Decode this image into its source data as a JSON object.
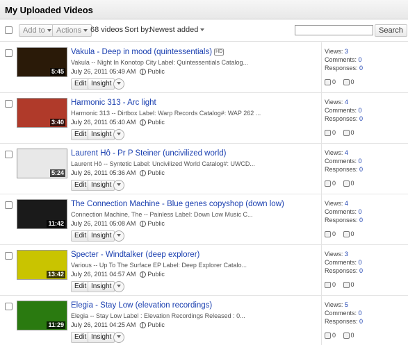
{
  "page_title": "My Uploaded Videos",
  "toolbar": {
    "add_to": "Add to",
    "actions": "Actions",
    "count": "68 videos",
    "sort_label": "Sort by:",
    "sort_value": "Newest added",
    "search_button": "Search",
    "search_value": ""
  },
  "row_labels": {
    "edit": "Edit",
    "insight": "Insight",
    "views": "Views:",
    "comments": "Comments:",
    "responses": "Responses:",
    "hd": "HD"
  },
  "videos": [
    {
      "title": "Vakula - Deep in mood (quintessentials)",
      "hd": true,
      "desc": "Vakula -- Night In Konotop City Label: Quintessentials Catalog...",
      "date": "July 26, 2011 05:49 AM",
      "privacy": "Public",
      "duration": "5:45",
      "views": "3",
      "comments": "0",
      "responses": "0",
      "likes": "0",
      "dislikes": "0",
      "thumb_color": "#2a1a08"
    },
    {
      "title": "Harmonic 313 - Arc light",
      "hd": false,
      "desc": "Harmonic 313 -- Dirtbox Label: Warp Records Catalog#: WAP 262 ...",
      "date": "July 26, 2011 05:40 AM",
      "privacy": "Public",
      "duration": "3:40",
      "views": "4",
      "comments": "0",
      "responses": "0",
      "likes": "0",
      "dislikes": "0",
      "thumb_color": "#b03a2a"
    },
    {
      "title": "Laurent Hô - Pr P Steiner (uncivilized world)",
      "hd": false,
      "desc": "Laurent Hô -- Syntetic Label: Uncivilized World Catalog#: UWCD...",
      "date": "July 26, 2011 05:36 AM",
      "privacy": "Public",
      "duration": "5:24",
      "views": "4",
      "comments": "0",
      "responses": "0",
      "likes": "0",
      "dislikes": "0",
      "thumb_color": "#e8e8e8"
    },
    {
      "title": "The Connection Machine - Blue genes copyshop (down low)",
      "hd": false,
      "desc": "Connection Machine, The -- Painless Label: Down Low Music C...",
      "date": "July 26, 2011 05:08 AM",
      "privacy": "Public",
      "duration": "11:42",
      "views": "4",
      "comments": "0",
      "responses": "0",
      "likes": "0",
      "dislikes": "0",
      "thumb_color": "#1a1a1a"
    },
    {
      "title": "Specter - Windtalker (deep explorer)",
      "hd": false,
      "desc": "Various -- Up To The Surface EP Label: Deep Explorer Catalo...",
      "date": "July 26, 2011 04:57 AM",
      "privacy": "Public",
      "duration": "13:42",
      "views": "3",
      "comments": "0",
      "responses": "0",
      "likes": "0",
      "dislikes": "0",
      "thumb_color": "#c9c400"
    },
    {
      "title": "Elegia - Stay Low (elevation recordings)",
      "hd": false,
      "desc": "Elegia -- Stay Low Label : Elevation Recordings Released : 0...",
      "date": "July 26, 2011 04:25 AM",
      "privacy": "Public",
      "duration": "11:29",
      "views": "5",
      "comments": "0",
      "responses": "0",
      "likes": "0",
      "dislikes": "0",
      "thumb_color": "#2a7a10"
    }
  ]
}
